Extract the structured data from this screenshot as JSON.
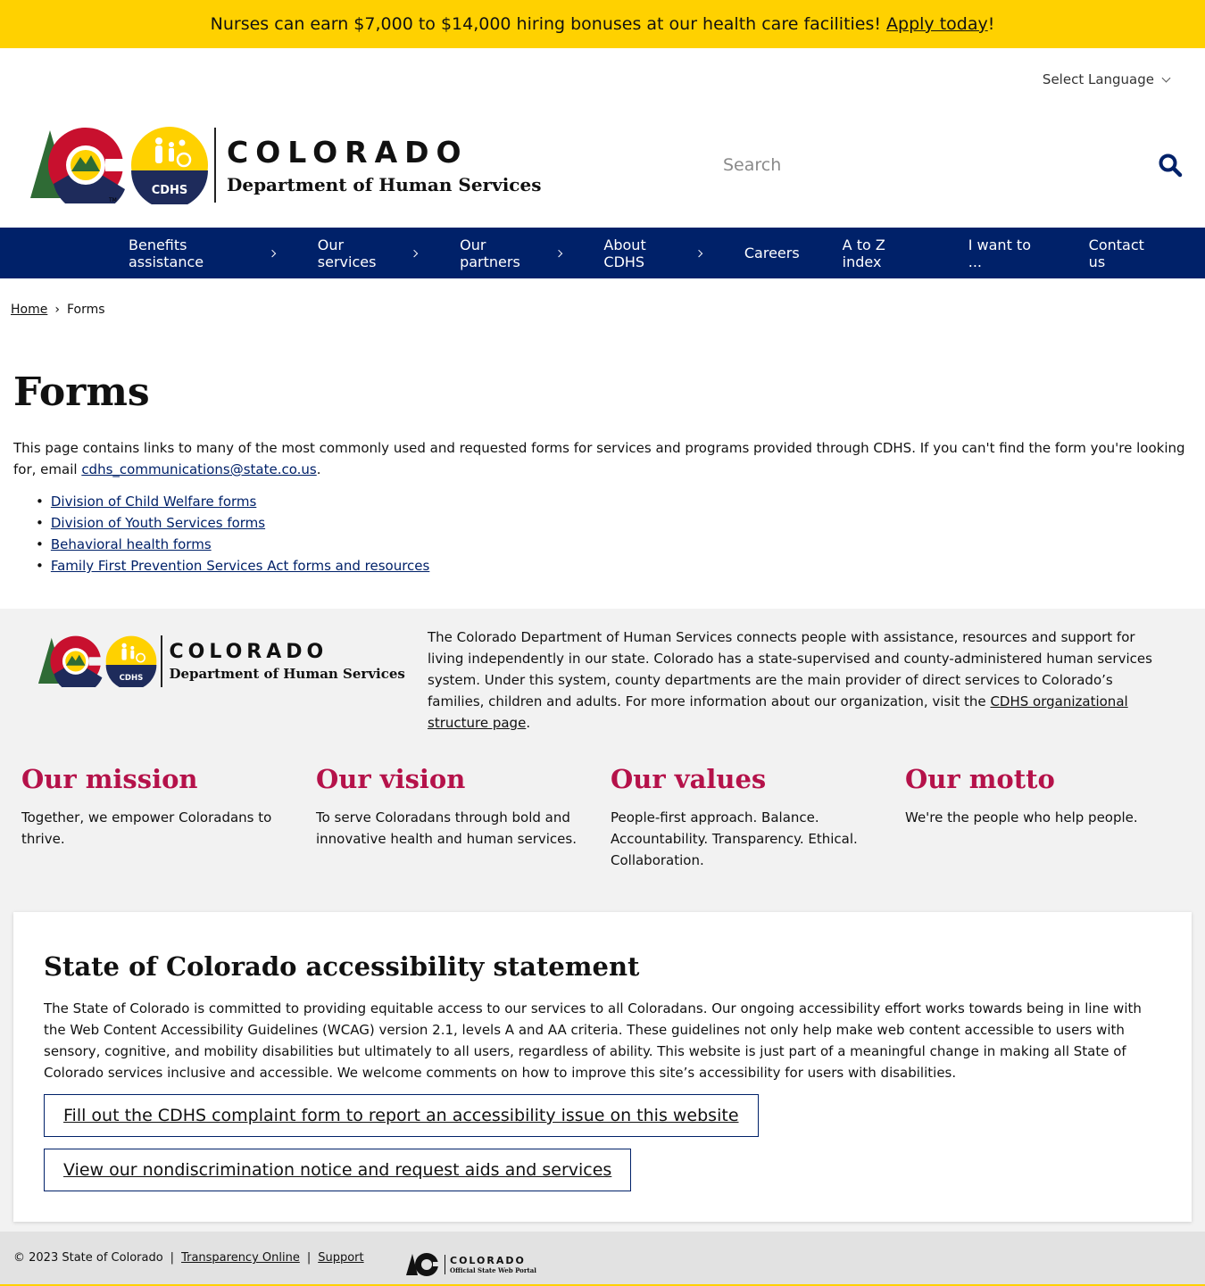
{
  "alert": {
    "text": "Nurses can earn $7,000 to $14,000 hiring bonuses at our health care facilities!",
    "link": "Apply today",
    "suffix": "!"
  },
  "language": {
    "label": "Select Language"
  },
  "brand": {
    "state": "COLORADO",
    "department": "Department of Human Services",
    "badge": "CDHS",
    "tm": "TM"
  },
  "search": {
    "placeholder": "Search"
  },
  "nav": {
    "items": [
      {
        "label": "Benefits assistance",
        "has_submenu": true
      },
      {
        "label": "Our services",
        "has_submenu": true
      },
      {
        "label": "Our partners",
        "has_submenu": true
      },
      {
        "label": "About CDHS",
        "has_submenu": true
      },
      {
        "label": "Careers",
        "has_submenu": false
      },
      {
        "label": "A to Z index",
        "has_submenu": false
      },
      {
        "label": "I want to ...",
        "has_submenu": false
      },
      {
        "label": "Contact us",
        "has_submenu": false
      }
    ]
  },
  "breadcrumb": {
    "home": "Home",
    "separator": "›",
    "current": "Forms"
  },
  "page": {
    "title": "Forms",
    "intro": "This page contains links to many of the most commonly used and requested forms for services and programs provided through CDHS. If you can't find the form you're looking for, email",
    "email": "cdhs_communications@state.co.us",
    "intro_end": ".",
    "links": [
      "Division of Child Welfare forms",
      "Division of Youth Services forms",
      "Behavioral health forms",
      "Family First Prevention Services Act forms and resources"
    ]
  },
  "footer": {
    "about": "The Colorado Department of Human Services connects people with assistance, resources and support for living independently in our state. Colorado has a state-supervised and county-administered human services system. Under this system, county departments are the main provider of direct services to Colorado’s families, children and adults. For more information about our organization, visit the",
    "about_link": "CDHS organizational structure page",
    "about_end": ".",
    "columns": [
      {
        "title": "Our mission",
        "text": "Together, we empower Coloradans to thrive."
      },
      {
        "title": "Our vision",
        "text": "To serve Coloradans through bold and innovative health and human services."
      },
      {
        "title": "Our values",
        "text": "People-first approach. Balance. Accountability. Transparency. Ethical. Collaboration."
      },
      {
        "title": "Our motto",
        "text": "We're the people who help people."
      }
    ],
    "accessibility": {
      "title": "State of Colorado accessibility statement",
      "text": "The State of Colorado is committed to providing equitable access to our services to all Coloradans. Our ongoing accessibility effort works towards being in line with the Web Content Accessibility Guidelines (WCAG) version 2.1, levels A and AA criteria. These guidelines not only help make web content accessible to users with sensory, cognitive, and mobility disabilities but ultimately to all users, regardless of ability. This website is just part of a meaningful change in making all State of Colorado services inclusive and accessible. We welcome comments on how to improve this site’s accessibility for users with disabilities.",
      "button1": "Fill out the CDHS complaint form to report an accessibility issue on this website",
      "button2": "View our nondiscrimination notice and request aids and services"
    },
    "bottom": {
      "copyright": "© 2023 State of Colorado",
      "sep": "|",
      "link1": "Transparency Online",
      "link2": "Support",
      "portal_title": "COLORADO",
      "portal_sub": "Official State Web Portal"
    }
  },
  "colors": {
    "navy": "#002169",
    "gold": "#ffd100",
    "accent": "#b5124a",
    "grey_bg": "#f2f2f2"
  },
  "icons": [
    "search-icon",
    "chevron-down-icon",
    "chevron-right-icon",
    "co-logo",
    "cdhs-badge"
  ]
}
